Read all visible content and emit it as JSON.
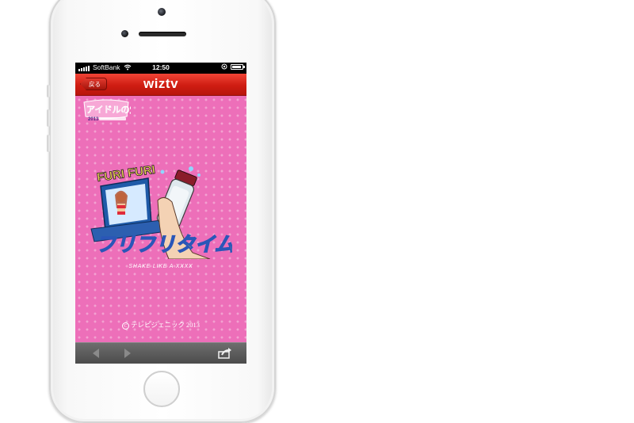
{
  "status_bar": {
    "carrier": "SoftBank",
    "time": "12:50"
  },
  "nav": {
    "back_label": "戻る",
    "title": "wiztv"
  },
  "content": {
    "logo_text": "アイドルの穴",
    "logo_year": "2013",
    "art_title_en": "FURI FURI",
    "art_title_jp": "フリフリタイム!",
    "tagline": "SHAKE LIKE A XXXX",
    "copyright_brand": "テレビジェニック",
    "copyright_year": "2013"
  },
  "toolbar": {
    "back_icon": "arrow-left-icon",
    "forward_icon": "arrow-right-icon",
    "share_icon": "share-icon"
  },
  "colors": {
    "navbar": "#d2241a",
    "background": "#ed6fb9",
    "toolbar": "#5a5a5a"
  }
}
